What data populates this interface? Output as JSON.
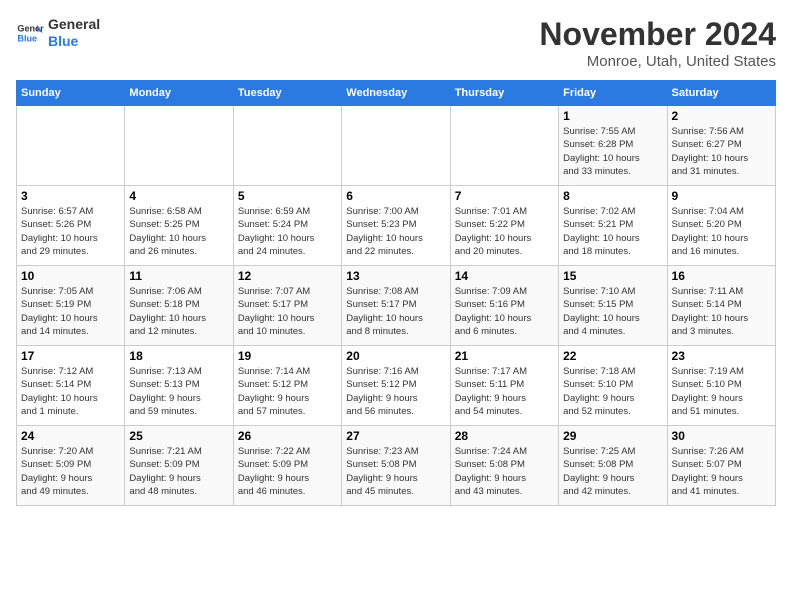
{
  "header": {
    "logo_general": "General",
    "logo_blue": "Blue",
    "month_title": "November 2024",
    "location": "Monroe, Utah, United States"
  },
  "weekdays": [
    "Sunday",
    "Monday",
    "Tuesday",
    "Wednesday",
    "Thursday",
    "Friday",
    "Saturday"
  ],
  "weeks": [
    [
      {
        "day": "",
        "info": ""
      },
      {
        "day": "",
        "info": ""
      },
      {
        "day": "",
        "info": ""
      },
      {
        "day": "",
        "info": ""
      },
      {
        "day": "",
        "info": ""
      },
      {
        "day": "1",
        "info": "Sunrise: 7:55 AM\nSunset: 6:28 PM\nDaylight: 10 hours\nand 33 minutes."
      },
      {
        "day": "2",
        "info": "Sunrise: 7:56 AM\nSunset: 6:27 PM\nDaylight: 10 hours\nand 31 minutes."
      }
    ],
    [
      {
        "day": "3",
        "info": "Sunrise: 6:57 AM\nSunset: 5:26 PM\nDaylight: 10 hours\nand 29 minutes."
      },
      {
        "day": "4",
        "info": "Sunrise: 6:58 AM\nSunset: 5:25 PM\nDaylight: 10 hours\nand 26 minutes."
      },
      {
        "day": "5",
        "info": "Sunrise: 6:59 AM\nSunset: 5:24 PM\nDaylight: 10 hours\nand 24 minutes."
      },
      {
        "day": "6",
        "info": "Sunrise: 7:00 AM\nSunset: 5:23 PM\nDaylight: 10 hours\nand 22 minutes."
      },
      {
        "day": "7",
        "info": "Sunrise: 7:01 AM\nSunset: 5:22 PM\nDaylight: 10 hours\nand 20 minutes."
      },
      {
        "day": "8",
        "info": "Sunrise: 7:02 AM\nSunset: 5:21 PM\nDaylight: 10 hours\nand 18 minutes."
      },
      {
        "day": "9",
        "info": "Sunrise: 7:04 AM\nSunset: 5:20 PM\nDaylight: 10 hours\nand 16 minutes."
      }
    ],
    [
      {
        "day": "10",
        "info": "Sunrise: 7:05 AM\nSunset: 5:19 PM\nDaylight: 10 hours\nand 14 minutes."
      },
      {
        "day": "11",
        "info": "Sunrise: 7:06 AM\nSunset: 5:18 PM\nDaylight: 10 hours\nand 12 minutes."
      },
      {
        "day": "12",
        "info": "Sunrise: 7:07 AM\nSunset: 5:17 PM\nDaylight: 10 hours\nand 10 minutes."
      },
      {
        "day": "13",
        "info": "Sunrise: 7:08 AM\nSunset: 5:17 PM\nDaylight: 10 hours\nand 8 minutes."
      },
      {
        "day": "14",
        "info": "Sunrise: 7:09 AM\nSunset: 5:16 PM\nDaylight: 10 hours\nand 6 minutes."
      },
      {
        "day": "15",
        "info": "Sunrise: 7:10 AM\nSunset: 5:15 PM\nDaylight: 10 hours\nand 4 minutes."
      },
      {
        "day": "16",
        "info": "Sunrise: 7:11 AM\nSunset: 5:14 PM\nDaylight: 10 hours\nand 3 minutes."
      }
    ],
    [
      {
        "day": "17",
        "info": "Sunrise: 7:12 AM\nSunset: 5:14 PM\nDaylight: 10 hours\nand 1 minute."
      },
      {
        "day": "18",
        "info": "Sunrise: 7:13 AM\nSunset: 5:13 PM\nDaylight: 9 hours\nand 59 minutes."
      },
      {
        "day": "19",
        "info": "Sunrise: 7:14 AM\nSunset: 5:12 PM\nDaylight: 9 hours\nand 57 minutes."
      },
      {
        "day": "20",
        "info": "Sunrise: 7:16 AM\nSunset: 5:12 PM\nDaylight: 9 hours\nand 56 minutes."
      },
      {
        "day": "21",
        "info": "Sunrise: 7:17 AM\nSunset: 5:11 PM\nDaylight: 9 hours\nand 54 minutes."
      },
      {
        "day": "22",
        "info": "Sunrise: 7:18 AM\nSunset: 5:10 PM\nDaylight: 9 hours\nand 52 minutes."
      },
      {
        "day": "23",
        "info": "Sunrise: 7:19 AM\nSunset: 5:10 PM\nDaylight: 9 hours\nand 51 minutes."
      }
    ],
    [
      {
        "day": "24",
        "info": "Sunrise: 7:20 AM\nSunset: 5:09 PM\nDaylight: 9 hours\nand 49 minutes."
      },
      {
        "day": "25",
        "info": "Sunrise: 7:21 AM\nSunset: 5:09 PM\nDaylight: 9 hours\nand 48 minutes."
      },
      {
        "day": "26",
        "info": "Sunrise: 7:22 AM\nSunset: 5:09 PM\nDaylight: 9 hours\nand 46 minutes."
      },
      {
        "day": "27",
        "info": "Sunrise: 7:23 AM\nSunset: 5:08 PM\nDaylight: 9 hours\nand 45 minutes."
      },
      {
        "day": "28",
        "info": "Sunrise: 7:24 AM\nSunset: 5:08 PM\nDaylight: 9 hours\nand 43 minutes."
      },
      {
        "day": "29",
        "info": "Sunrise: 7:25 AM\nSunset: 5:08 PM\nDaylight: 9 hours\nand 42 minutes."
      },
      {
        "day": "30",
        "info": "Sunrise: 7:26 AM\nSunset: 5:07 PM\nDaylight: 9 hours\nand 41 minutes."
      }
    ]
  ]
}
